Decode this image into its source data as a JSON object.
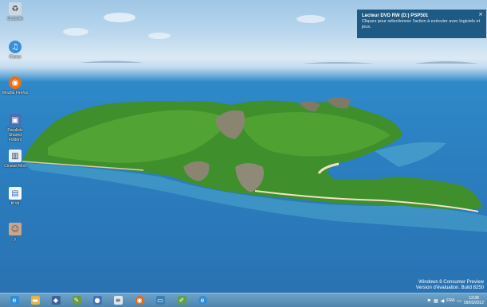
{
  "desktop_icons": [
    {
      "name": "corbeille",
      "label": "Corbeille",
      "icon": "recycle-bin-icon"
    },
    {
      "name": "itunes",
      "label": "iTunes",
      "icon": "itunes-icon"
    },
    {
      "name": "firefox",
      "label": "Mozilla Firefox",
      "icon": "firefox-icon"
    },
    {
      "name": "parallels",
      "label": "Parallels Shared Folders",
      "icon": "parallels-folder-icon"
    },
    {
      "name": "cinstall",
      "label": "Cinstall Mod",
      "icon": "installer-icon"
    },
    {
      "name": "file",
      "label": "tif.vb",
      "icon": "file-icon"
    },
    {
      "name": "user",
      "label": "y",
      "icon": "user-photo-icon"
    }
  ],
  "toast": {
    "title": "Lecteur DVD RW (D:) PSP501",
    "body": "Cliquez pour sélectionner l'action à exécuter avec logiciels et jeux.",
    "close": "×"
  },
  "watermark": {
    "line1": "Windows 8 Consumer Preview",
    "line2": "Version d'évaluation. Build 8250"
  },
  "taskbar": {
    "apps": [
      {
        "name": "internet-explorer",
        "icon": "ie-icon",
        "glyph": "e",
        "color": "#2d8fd6"
      },
      {
        "name": "file-explorer",
        "icon": "folder-icon",
        "glyph": "▬",
        "color": "#e3b54a"
      },
      {
        "name": "security",
        "icon": "shield-icon",
        "glyph": "◆",
        "color": "#4060a0"
      },
      {
        "name": "paint",
        "icon": "palette-icon",
        "glyph": "✎",
        "color": "#6a9b3c"
      },
      {
        "name": "media",
        "icon": "globe-icon",
        "glyph": "●",
        "color": "#3f74b8"
      },
      {
        "name": "notepad",
        "icon": "notepad-icon",
        "glyph": "≡",
        "color": "#dfe6ee"
      },
      {
        "name": "firefox",
        "icon": "firefox-icon",
        "glyph": "◉",
        "color": "#e36a1a"
      },
      {
        "name": "desktop-app",
        "icon": "monitor-icon",
        "glyph": "▭",
        "color": "#3c7fb0"
      },
      {
        "name": "paint-2",
        "icon": "brush-icon",
        "glyph": "✐",
        "color": "#5ca04a"
      },
      {
        "name": "ie-2",
        "icon": "ie-icon",
        "glyph": "e",
        "color": "#2d8fd6"
      }
    ],
    "tray": {
      "language": "FRA",
      "time": "13:38",
      "date": "09/03/2012"
    }
  }
}
